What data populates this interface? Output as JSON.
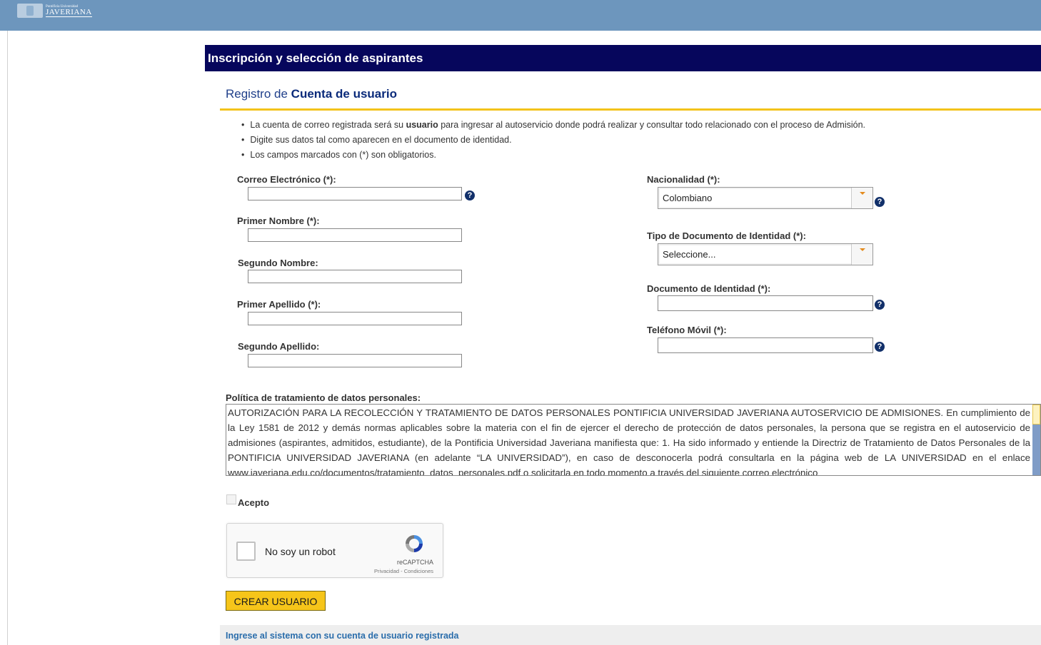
{
  "header": {
    "logo_small": "Pontificia Universidad",
    "logo_big": "JAVERIANA"
  },
  "title_bar": "Inscripción y selección de aspirantes",
  "section": {
    "prefix": "Registro de ",
    "emphasis": "Cuenta de usuario"
  },
  "bullets": {
    "b1_pre": "La cuenta de correo registrada será su ",
    "b1_bold": "usuario",
    "b1_post": " para ingresar al autoservicio donde podrá realizar y consultar todo relacionado con el proceso de Admisión.",
    "b2": "Digite sus datos tal como aparecen en el documento de identidad.",
    "b3": "Los campos marcados con (*) son obligatorios."
  },
  "form": {
    "email_label": "Correo Electrónico (*):",
    "first_name_label": "Primer Nombre (*):",
    "second_name_label": "Segundo Nombre:",
    "first_surname_label": "Primer Apellido (*):",
    "second_surname_label": "Segundo Apellido:",
    "nationality_label": "Nacionalidad (*):",
    "nationality_value": "Colombiano",
    "doc_type_label": "Tipo de Documento de Identidad (*):",
    "doc_type_value": "Seleccione...",
    "doc_number_label": "Documento de Identidad (*):",
    "mobile_label": "Teléfono Móvil (*):",
    "help_glyph": "?"
  },
  "policy": {
    "label": "Política de tratamiento de datos personales:",
    "text": "AUTORIZACIÓN PARA LA RECOLECCIÓN Y TRATAMIENTO DE DATOS PERSONALES PONTIFICIA UNIVERSIDAD JAVERIANA AUTOSERVICIO DE ADMISIONES. En cumplimiento de la Ley 1581 de 2012 y demás normas aplicables sobre la materia con el fin de ejercer el derecho de protección de datos personales, la persona que se registra en el autoservicio de admisiones (aspirantes, admitidos, estudiante), de la Pontificia Universidad Javeriana manifiesta que: 1. Ha sido informado y entiende la Directriz de Tratamiento de Datos Personales de la PONTIFICIA UNIVERSIDAD JAVERIANA (en adelante “LA UNIVERSIDAD”), en caso de desconocerla podrá consultarla en la página web de LA UNIVERSIDAD en el enlace www.javeriana.edu.co/documentos/tratamiento_datos_personales.pdf o solicitarla en todo momento a través del siguiente correo electrónico"
  },
  "accept_label": "Acepto",
  "recaptcha": {
    "label": "No soy un robot",
    "brand": "reCAPTCHA",
    "terms": "Privacidad - Condiciones"
  },
  "create_button": "CREAR USUARIO",
  "login_link": "Ingrese al sistema con su cuenta de usuario registrada"
}
